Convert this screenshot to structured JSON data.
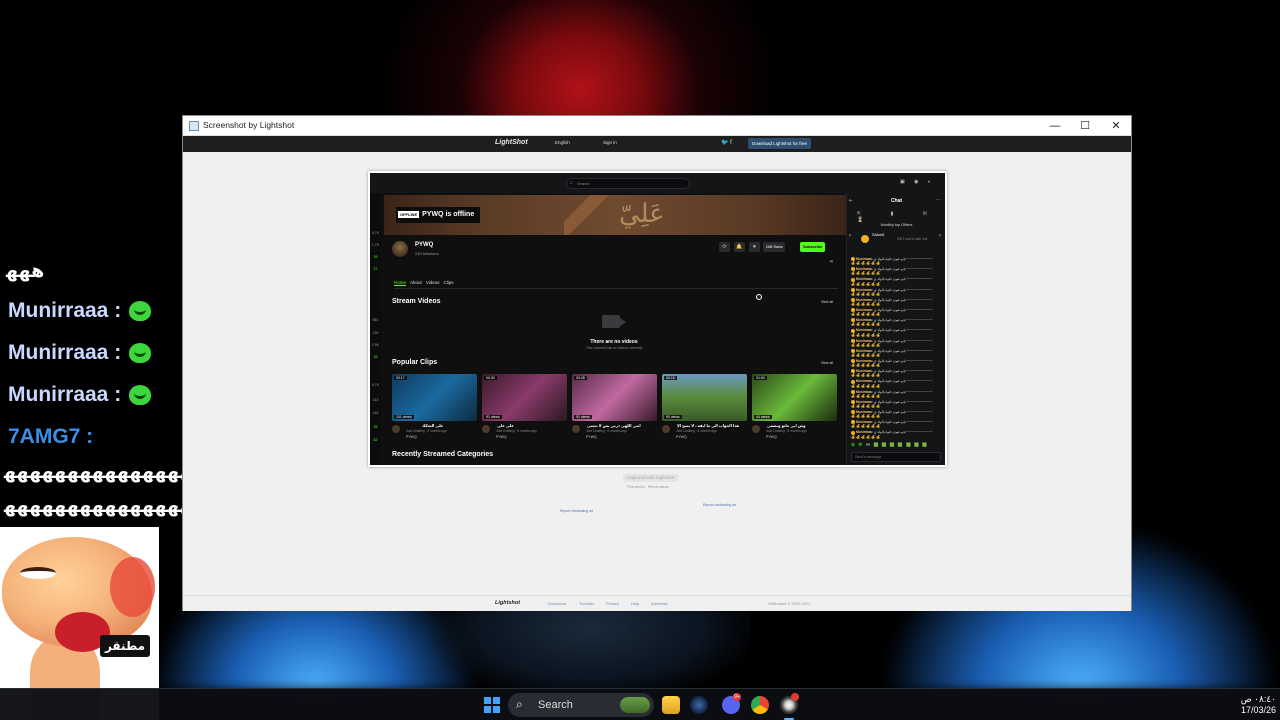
{
  "overlay_chat": {
    "lines": [
      {
        "text": "ﻫﻬﻬ",
        "emote": false
      },
      {
        "text": "Munirraaa :",
        "emote": true
      },
      {
        "text": "Munirraaa :",
        "emote": true
      },
      {
        "text": "Munirraaa :",
        "emote": true
      },
      {
        "text": "7AMG7 :",
        "emote": false
      },
      {
        "text": "ﻫﻬﻬﻬﻬﻬﻬﻬﻬﻬﻬﻬﻬﻬﻬﻬﻬﻬﻬﻬﻬﻬﻬﻬﻬﻬﻬﻬﻬﻬﻬﻬﻬﻬ",
        "emote": false
      },
      {
        "text": "ﻫﻬﻬﻬﻬﻬﻬﻬﻬﻬﻬﻬﻬﻬﻬﻬﻬﻬﻬﻬﻬﻬﻬﻬﻬﻬﻬﻬﻬﻬﻬﻬﻬ",
        "emote": false
      }
    ],
    "meme_caption": "مطنقر"
  },
  "window": {
    "title": "Screenshot by Lightshot",
    "controls": {
      "minimize": "—",
      "maximize": "☐",
      "close": "✕"
    }
  },
  "lightshot": {
    "logo": "LightShot",
    "language": "English",
    "sign_in": "Sign in",
    "social": "🐦 f",
    "download_label": "Download Lightshot for free",
    "captured": "Captured with Lightshot",
    "under_links": [
      "Find similar",
      "Report abuse"
    ],
    "report_left": "Report misleading ad",
    "report_right": "Report misleading ad",
    "footer": {
      "logo": "Lightshot",
      "links": [
        "Download",
        "Tutorials",
        "Privacy",
        "Help",
        "Advertise"
      ],
      "copyright": "Skillbrains © 2009-2022"
    }
  },
  "kick": {
    "search_placeholder": "Search",
    "top_icons": "▣ ◉ ◐",
    "rail_numbers": [
      "5.7K",
      "1.7K",
      "39",
      "37",
      "651",
      "190",
      "2.5K",
      "35",
      "6.7K",
      "213",
      "162",
      "35",
      "82"
    ],
    "offline_tag": "OFFLINE",
    "offline_text": "PYWQ is offline",
    "banner_text": "عَلِيّ",
    "channel": {
      "name": "PYWQ",
      "followers": "249 followers"
    },
    "actions": {
      "gift": "Gift Subs",
      "subscribe": "Subscribe"
    },
    "tabs": [
      "Home",
      "About",
      "Videos",
      "Clips"
    ],
    "stream_videos": "Stream Videos",
    "view_all": "View all",
    "no_videos_title": "There are no videos",
    "no_videos_sub": "This channel has no videos currently",
    "popular_clips": "Popular Clips",
    "recent_categories": "Recently Streamed Categories",
    "clips": [
      {
        "duration": "00:17",
        "views": "101 views",
        "title": "على الشكك",
        "meta": "Just Chatting · 8 months ago",
        "channel": "PYWQ",
        "color": "#1a5a8a"
      },
      {
        "duration": "00:30",
        "views": "91 views",
        "title": "على على",
        "meta": "Just Chatting · 8 months ago",
        "channel": "PYWQ",
        "color": "#7a3a6a"
      },
      {
        "duration": "00:28",
        "views": "91 views",
        "title": "انتي اللهي ذرتي بس لا تنسى",
        "meta": "Just Chatting · 8 months ago",
        "channel": "PYWQ",
        "color": "#9a4a7a"
      },
      {
        "duration": "00:15",
        "views": "90 views",
        "title": "هذا الجواب الي ما ابقه ، لا يسح الا",
        "meta": "Just Chatting · 8 months ago",
        "channel": "PYWQ",
        "color": "#4a7a3a"
      },
      {
        "duration": "01:00",
        "views": "44 views",
        "title": "وش ابي ماتو ويضغى",
        "meta": "Just Chatting · 8 months ago",
        "channel": "PYWQ",
        "color": "#3a6a2a"
      }
    ],
    "chat": {
      "title": "Chat",
      "collapse": "⇤",
      "more": "⋯",
      "icons": "⇱ ▮ ✉ ⏳",
      "monthly_gifters": "Monthly top Gifters",
      "gifter_name": "SAkm5",
      "gifter_hint": "Gift 1 sub to take 2nd",
      "username": "Munirraaa:",
      "message": "يابو عيون حلوة يالولد ي~~~~~~~~~~~~~~",
      "emotes_row": "💰 💰 💰 💰 💰 💰",
      "emote_bar": "😀 😎 🎮 🟩 🟩 🟩 🟩 🟩 🟩 🟩",
      "input_placeholder": "Send a message"
    }
  },
  "taskbar": {
    "search": "Search",
    "clock_time": "٠٨:٤٠ ص",
    "clock_date": "17/03/26",
    "discord_badge": "9+"
  }
}
